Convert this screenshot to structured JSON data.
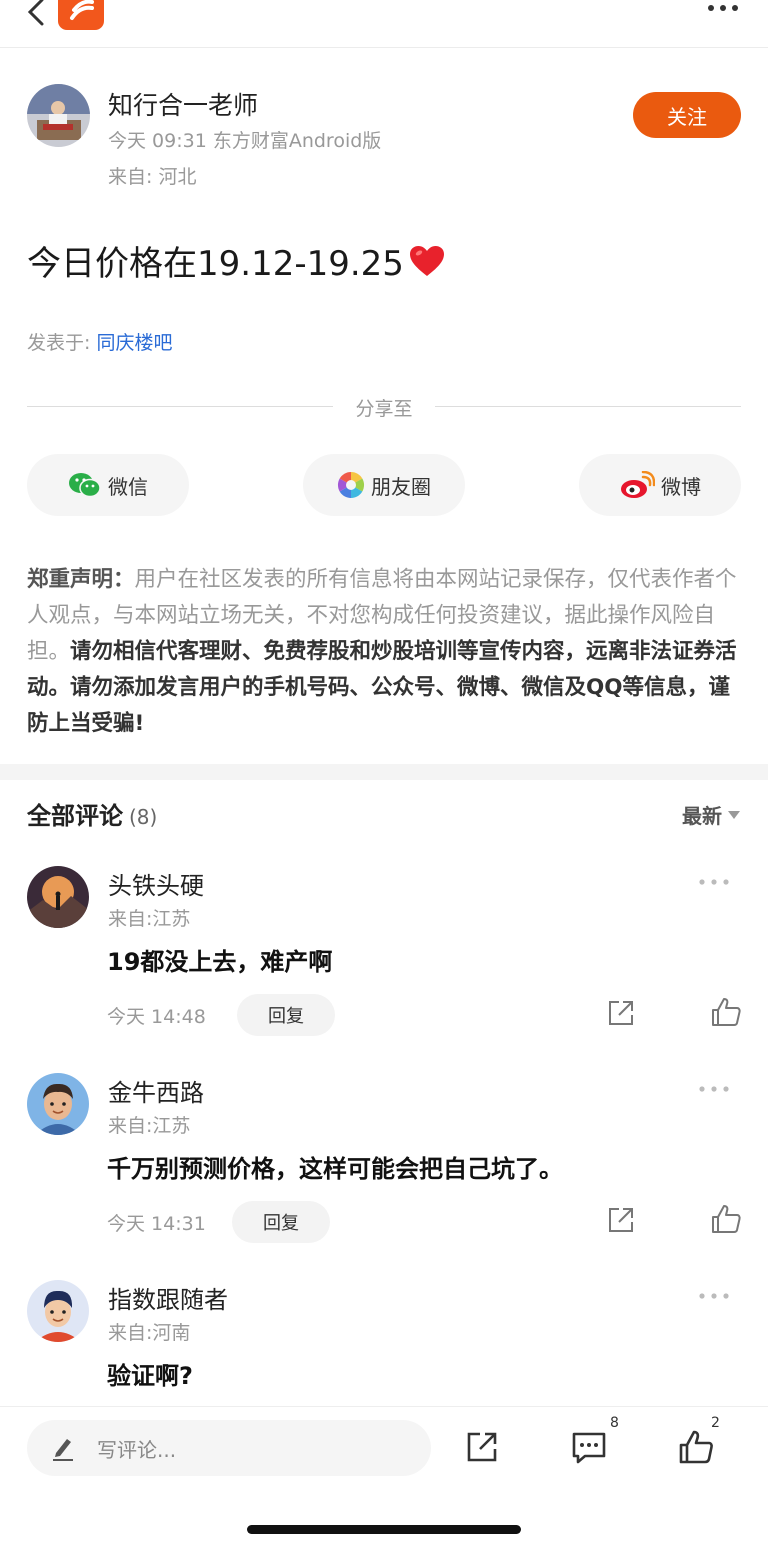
{
  "author": {
    "name": "知行合一老师",
    "meta": "今天 09:31 东方财富Android版",
    "location": "来自: 河北",
    "follow_label": "关注"
  },
  "post": {
    "text": "今日价格在19.12-19.25",
    "posted_in_label": "发表于:",
    "forum": "同庆楼吧"
  },
  "share": {
    "title": "分享至",
    "wechat": "微信",
    "moments": "朋友圈",
    "weibo": "微博"
  },
  "disclaimer": {
    "label": "郑重声明：",
    "text1": "用户在社区发表的所有信息将由本网站记录保存，仅代表作者个人观点，与本网站立场无关，不对您构成任何投资建议，据此操作风险自担。",
    "text2": "请勿相信代客理财、免费荐股和炒股培训等宣传内容，远离非法证券活动。请勿添加发言用户的手机号码、公众号、微博、微信及QQ等信息，谨防上当受骗!"
  },
  "comments_section": {
    "title": "全部评论",
    "count": "(8)",
    "sort": "最新"
  },
  "comments": [
    {
      "name": "头铁头硬",
      "location": "来自:江苏",
      "text": "19都没上去，难产啊",
      "time": "今天 14:48",
      "reply": "回复"
    },
    {
      "name": "金牛西路",
      "location": "来自:江苏",
      "text": "千万别预测价格，这样可能会把自己坑了。",
      "time": "今天 14:31",
      "reply": "回复"
    },
    {
      "name": "指数跟随者",
      "location": "来自:河南",
      "text": "验证啊?"
    }
  ],
  "bottom": {
    "input_placeholder": "写评论...",
    "comment_count": "8",
    "like_count": "2"
  },
  "colors": {
    "accent": "#ea5a0f",
    "link": "#2a6bd6"
  }
}
